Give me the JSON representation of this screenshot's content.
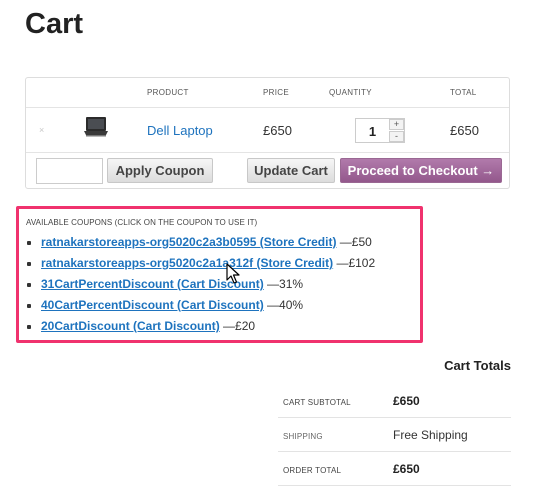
{
  "page": {
    "title": "Cart"
  },
  "cart": {
    "headers": {
      "product": "PRODUCT",
      "price": "PRICE",
      "quantity": "QUANTITY",
      "total": "TOTAL"
    },
    "item": {
      "remove_glyph": "×",
      "product_name": "Dell Laptop",
      "product_icon": "laptop-thumbnail",
      "price": "£650",
      "quantity": "1",
      "qty_plus": "+",
      "qty_minus": "-",
      "total": "£650"
    },
    "actions": {
      "coupon_placeholder": "",
      "apply_coupon": "Apply Coupon",
      "update_cart": "Update Cart",
      "checkout": "Proceed to Checkout →"
    }
  },
  "coupons": {
    "heading": "AVAILABLE COUPONS (CLICK ON THE COUPON TO USE IT)",
    "items": [
      {
        "name": "ratnakarstoreapps-org5020c2a3b0595 (Store Credit)",
        "amount": " —£50"
      },
      {
        "name": "ratnakarstoreapps-org5020c2a1a312f (Store Credit)",
        "amount": " —£102"
      },
      {
        "name": "31CartPercentDiscount (Cart Discount)",
        "amount": " —31%"
      },
      {
        "name": "40CartPercentDiscount (Cart Discount)",
        "amount": " —40%"
      },
      {
        "name": "20CartDiscount (Cart Discount)",
        "amount": " —£20"
      }
    ],
    "highlight_color": "#f0326e"
  },
  "totals": {
    "title": "Cart Totals",
    "rows": [
      {
        "label": "CART SUBTOTAL",
        "value": "£650"
      },
      {
        "label": "SHIPPING",
        "value": "Free Shipping"
      },
      {
        "label": "ORDER TOTAL",
        "value": "£650"
      }
    ]
  },
  "colors": {
    "link": "#1e73be",
    "checkout": "#a36b9d",
    "highlight": "#f0326e"
  },
  "cursor": {
    "icon": "mouse-pointer-icon"
  }
}
